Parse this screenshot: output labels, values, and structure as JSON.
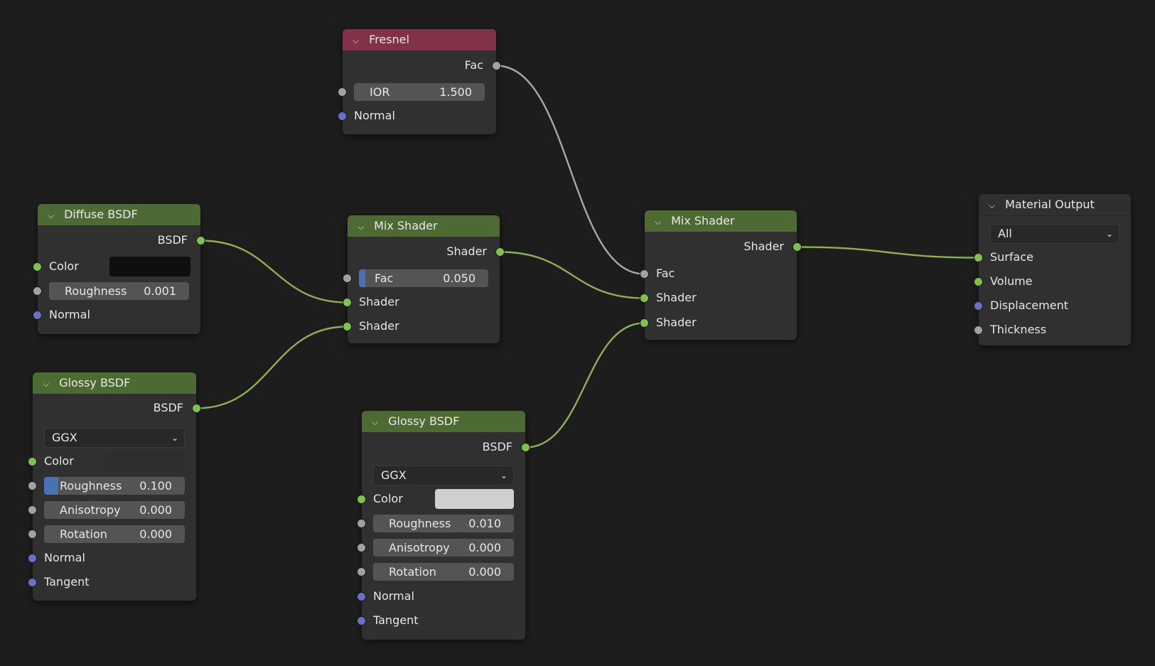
{
  "colors": {
    "background": "#1d1d1d",
    "shader_header": "#4c6a31",
    "input_header": "#83314a",
    "shader_socket": "#7fc24a",
    "float_socket": "#a1a1a1",
    "vector_socket": "#6870c8",
    "field_fill": "#4772b3",
    "diffuse_color": "#0f0f0f",
    "glossy1_color": "#2e2e2e",
    "glossy2_color": "#cfcfcf"
  },
  "icons": {
    "collapse": "chevron-down-icon",
    "dropdown": "chevron-down-icon"
  },
  "fresnel": {
    "title": "Fresnel",
    "out_fac": "Fac",
    "ior_label": "IOR",
    "ior_value": "1.500",
    "normal": "Normal"
  },
  "diffuse": {
    "title": "Diffuse BSDF",
    "out_bsdf": "BSDF",
    "color_label": "Color",
    "roughness_label": "Roughness",
    "roughness_value": "0.001",
    "normal": "Normal"
  },
  "mix1": {
    "title": "Mix Shader",
    "out_shader": "Shader",
    "fac_label": "Fac",
    "fac_value": "0.050",
    "fac_fraction": 0.05,
    "shader_a": "Shader",
    "shader_b": "Shader"
  },
  "mix2": {
    "title": "Mix Shader",
    "out_shader": "Shader",
    "fac": "Fac",
    "shader_a": "Shader",
    "shader_b": "Shader"
  },
  "output": {
    "title": "Material Output",
    "target": "All",
    "surface": "Surface",
    "volume": "Volume",
    "displacement": "Displacement",
    "thickness": "Thickness"
  },
  "glossy1": {
    "title": "Glossy BSDF",
    "out_bsdf": "BSDF",
    "distribution": "GGX",
    "color_label": "Color",
    "roughness_label": "Roughness",
    "roughness_value": "0.100",
    "roughness_fraction": 0.1,
    "anisotropy_label": "Anisotropy",
    "anisotropy_value": "0.000",
    "rotation_label": "Rotation",
    "rotation_value": "0.000",
    "normal": "Normal",
    "tangent": "Tangent"
  },
  "glossy2": {
    "title": "Glossy BSDF",
    "out_bsdf": "BSDF",
    "distribution": "GGX",
    "color_label": "Color",
    "roughness_label": "Roughness",
    "roughness_value": "0.010",
    "anisotropy_label": "Anisotropy",
    "anisotropy_value": "0.000",
    "rotation_label": "Rotation",
    "rotation_value": "0.000",
    "normal": "Normal",
    "tangent": "Tangent"
  }
}
